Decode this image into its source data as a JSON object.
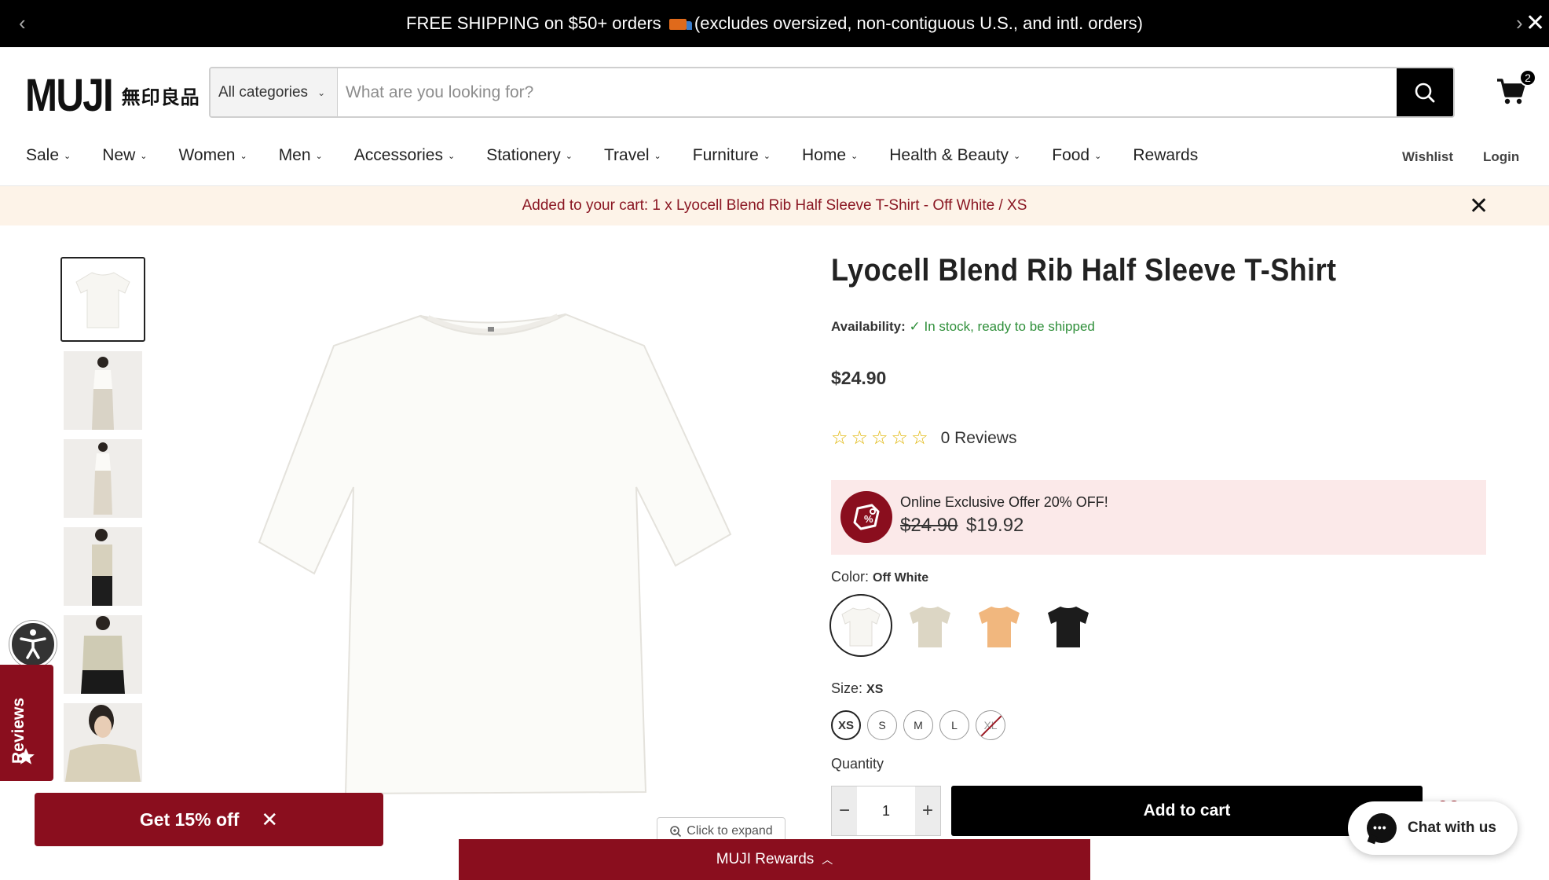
{
  "announcement": {
    "text_before": "FREE SHIPPING on $50+ orders",
    "text_after": "(excludes oversized, non-contiguous U.S., and intl. orders)"
  },
  "header": {
    "logo_text": "MUJI",
    "logo_kanji": "無印良品",
    "search": {
      "category": "All categories",
      "placeholder": "What are you looking for?"
    },
    "cart_count": "2"
  },
  "nav": {
    "items": [
      {
        "label": "Sale",
        "dropdown": true
      },
      {
        "label": "New",
        "dropdown": true
      },
      {
        "label": "Women",
        "dropdown": true
      },
      {
        "label": "Men",
        "dropdown": true
      },
      {
        "label": "Accessories",
        "dropdown": true
      },
      {
        "label": "Stationery",
        "dropdown": true
      },
      {
        "label": "Travel",
        "dropdown": true
      },
      {
        "label": "Furniture",
        "dropdown": true
      },
      {
        "label": "Home",
        "dropdown": true
      },
      {
        "label": "Health & Beauty",
        "dropdown": true
      },
      {
        "label": "Food",
        "dropdown": true
      },
      {
        "label": "Rewards",
        "dropdown": false
      }
    ],
    "wishlist": "Wishlist",
    "login": "Login"
  },
  "notice": {
    "text": "Added to your cart: 1 x Lyocell Blend Rib Half Sleeve T-Shirt - Off White / XS"
  },
  "gallery": {
    "expand_label": "Click to expand"
  },
  "product": {
    "title": "Lyocell Blend Rib Half Sleeve T-Shirt",
    "availability_label": "Availability:",
    "availability_value": "In stock, ready to be shipped",
    "price": "$24.90",
    "rating": 0,
    "reviews": "0 Reviews",
    "offer": {
      "title": "Online Exclusive Offer 20% OFF!",
      "old_price": "$24.90",
      "new_price": "$19.92"
    },
    "color_label": "Color:",
    "color_value": "Off White",
    "colors": [
      "Off White",
      "Beige",
      "Light Orange",
      "Black"
    ],
    "size_label": "Size:",
    "size_value": "XS",
    "sizes": [
      {
        "label": "XS",
        "selected": true,
        "available": true
      },
      {
        "label": "S",
        "selected": false,
        "available": true
      },
      {
        "label": "M",
        "selected": false,
        "available": true
      },
      {
        "label": "L",
        "selected": false,
        "available": true
      },
      {
        "label": "XL",
        "selected": false,
        "available": false
      }
    ],
    "quantity_label": "Quantity",
    "quantity": "1",
    "add_to_cart": "Add to cart"
  },
  "widgets": {
    "reviews_tab": "Reviews",
    "get_offer": "Get 15% off",
    "rewards_bar": "MUJI Rewards",
    "chat": "Chat with us"
  },
  "colors": {
    "brand_red": "#8a0e1e",
    "success_green": "#2f8f3a",
    "star_yellow": "#e0b400"
  }
}
